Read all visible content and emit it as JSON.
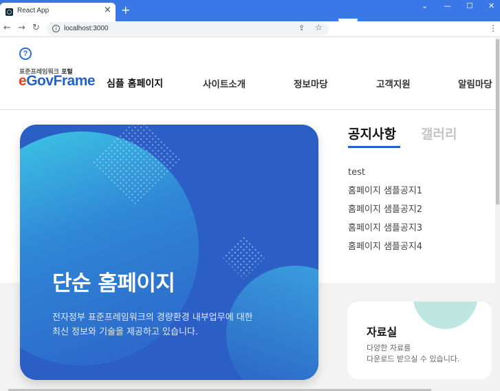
{
  "browser": {
    "tab_title": "React App",
    "tab_close": "×",
    "new_tab": "+",
    "url": "localhost:3000",
    "controls": {
      "chevron": "⌄",
      "minimize": "—",
      "maximize": "☐",
      "close": "✕"
    }
  },
  "header": {
    "help": "?",
    "logo_small_prefix": "표준프레임워크 ",
    "logo_small_bold": "포털",
    "logo_e": "e",
    "logo_rest": "GovFrame",
    "logo_sub": "심플 홈페이지",
    "nav": [
      "사이트소개",
      "정보마당",
      "고객지원",
      "알림마당"
    ]
  },
  "hero": {
    "title": "단순 홈페이지",
    "desc_line1": "전자정부 표준프레임워크의 경량환경 내부업무에 대한",
    "desc_line2": "최신 정보와 기술을 제공하고 있습니다."
  },
  "notice": {
    "tab_active": "공지사항",
    "tab_inactive": "갤러리",
    "items": [
      "test",
      "홈페이지 샘플공지1",
      "홈페이지 샘플공지2",
      "홈페이지 샘플공지3",
      "홈페이지 샘플공지4"
    ]
  },
  "card": {
    "title": "자료실",
    "desc_line1": "다양한 자료를",
    "desc_line2": "다운로드 받으실 수 있습니다."
  },
  "colors": {
    "brand_blue": "#2262cc",
    "logo_red": "#e8451f",
    "titlebar": "#3b78e7"
  }
}
